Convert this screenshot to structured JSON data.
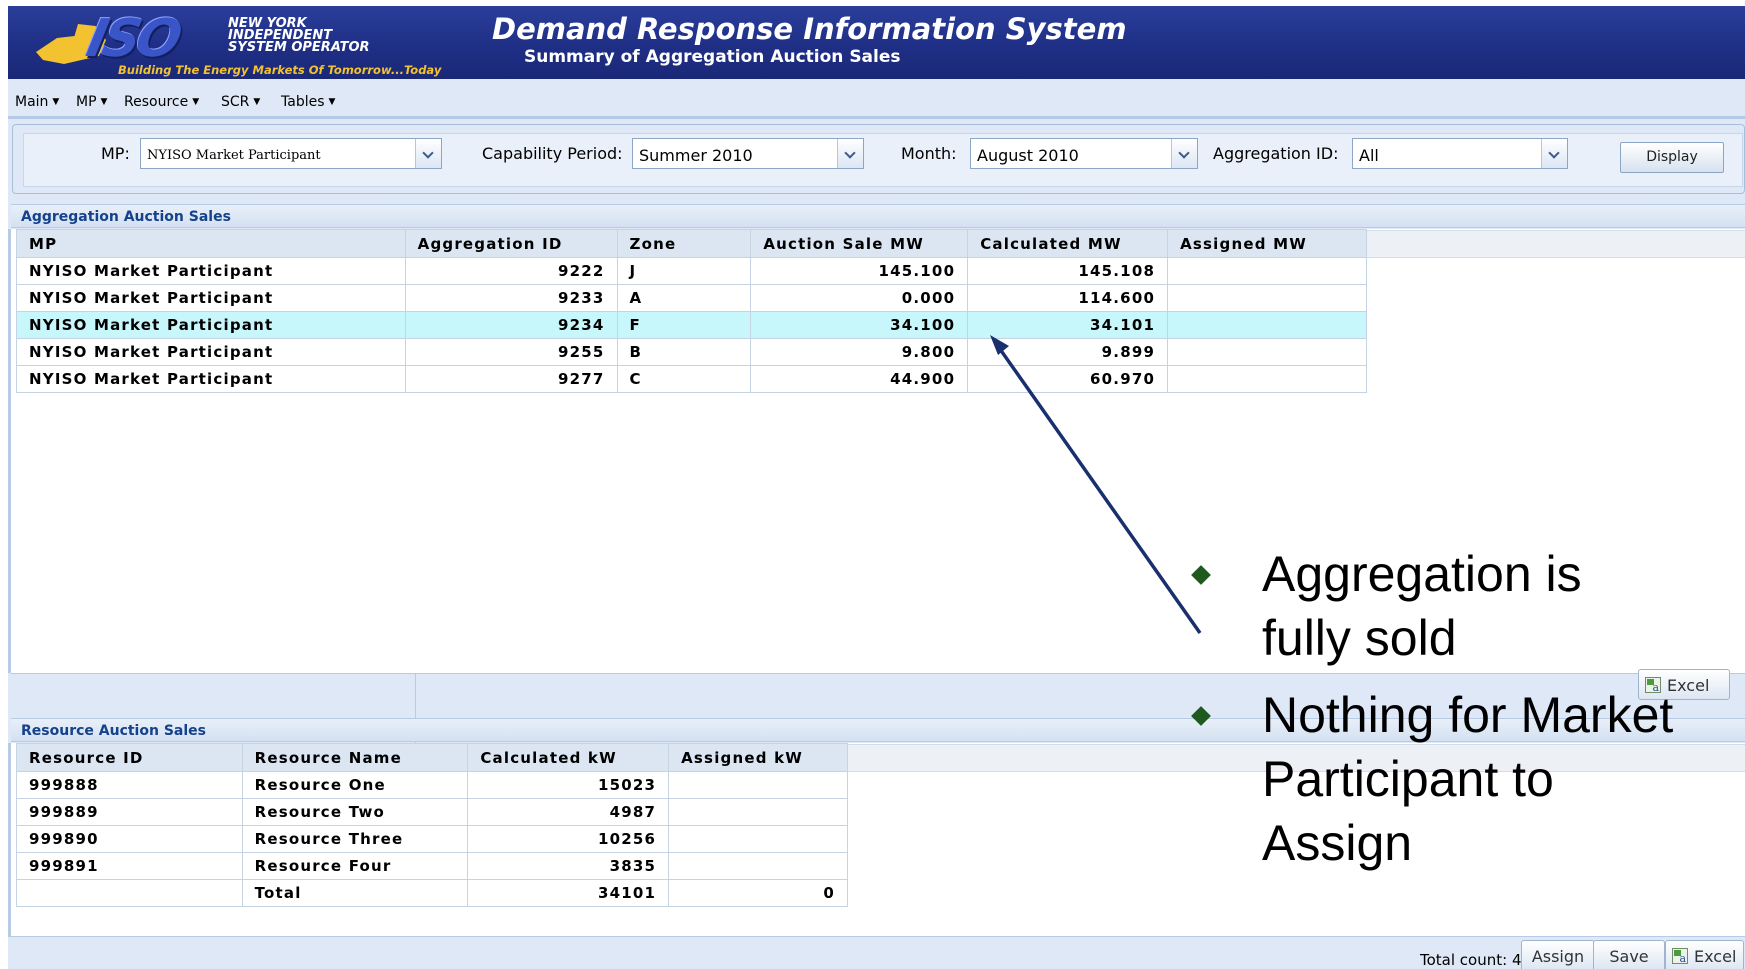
{
  "banner": {
    "logo_mark": "ISO",
    "logo_name_lines": [
      "NEW YORK",
      "INDEPENDENT",
      "SYSTEM OPERATOR"
    ],
    "logo_tagline": "Building The Energy Markets Of Tomorrow...Today",
    "title": "Demand Response Information System",
    "subtitle": "Summary of Aggregation Auction Sales"
  },
  "menu": {
    "items": [
      {
        "label": "Main"
      },
      {
        "label": "MP"
      },
      {
        "label": "Resource"
      },
      {
        "label": "SCR"
      },
      {
        "label": "Tables"
      }
    ]
  },
  "filters": {
    "mp_label": "MP:",
    "mp_value": "NYISO Market Participant",
    "capability_label": "Capability Period:",
    "capability_value": "Summer 2010",
    "month_label": "Month:",
    "month_value": "August 2010",
    "aggregation_label": "Aggregation ID:",
    "aggregation_value": "All",
    "display_button": "Display"
  },
  "aggregation_panel": {
    "title": "Aggregation Auction Sales",
    "columns": [
      "MP",
      "Aggregation ID",
      "Zone",
      "Auction Sale MW",
      "Calculated MW",
      "Assigned MW"
    ],
    "rows": [
      {
        "mp": "NYISO Market Participant",
        "agg_id": "9222",
        "zone": "J",
        "auction_mw": "145.100",
        "calc_mw": "145.108",
        "assigned_mw": ""
      },
      {
        "mp": "NYISO Market Participant",
        "agg_id": "9233",
        "zone": "A",
        "auction_mw": "0.000",
        "calc_mw": "114.600",
        "assigned_mw": ""
      },
      {
        "mp": "NYISO Market Participant",
        "agg_id": "9234",
        "zone": "F",
        "auction_mw": "34.100",
        "calc_mw": "34.101",
        "assigned_mw": ""
      },
      {
        "mp": "NYISO Market Participant",
        "agg_id": "9255",
        "zone": "B",
        "auction_mw": "9.800",
        "calc_mw": "9.899",
        "assigned_mw": ""
      },
      {
        "mp": "NYISO Market Participant",
        "agg_id": "9277",
        "zone": "C",
        "auction_mw": "44.900",
        "calc_mw": "60.970",
        "assigned_mw": ""
      }
    ],
    "selected_row": 2,
    "selected_color": "#c8f7fb",
    "excel_button": "Excel"
  },
  "resource_panel": {
    "title": "Resource Auction Sales",
    "columns": [
      "Resource ID",
      "Resource Name",
      "Calculated kW",
      "Assigned kW"
    ],
    "rows": [
      {
        "id": "999888",
        "name": "Resource One",
        "calc_kw": "15023",
        "assigned_kw": ""
      },
      {
        "id": "999889",
        "name": "Resource Two",
        "calc_kw": "4987",
        "assigned_kw": ""
      },
      {
        "id": "999890",
        "name": "Resource Three",
        "calc_kw": "10256",
        "assigned_kw": ""
      },
      {
        "id": "999891",
        "name": "Resource Four",
        "calc_kw": "3835",
        "assigned_kw": ""
      }
    ],
    "total": {
      "id": "",
      "name": "Total",
      "calc_kw": "34101",
      "assigned_kw": "0"
    }
  },
  "bottom_toolbar": {
    "total_count": "Total count: 4",
    "assign_button": "Assign",
    "save_button": "Save",
    "excel_button": "Excel"
  },
  "annotation": {
    "notes": [
      {
        "lines": [
          "Aggregation is",
          "fully sold"
        ]
      },
      {
        "lines": [
          "Nothing for Market",
          "Participant to",
          "Assign"
        ]
      }
    ],
    "arrow_color": "#1a2f6e",
    "bullet_color": "#1e5a1e"
  }
}
